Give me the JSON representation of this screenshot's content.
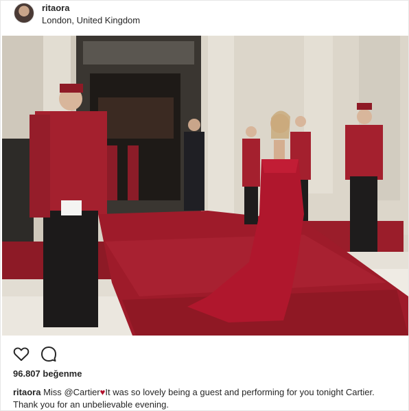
{
  "header": {
    "username": "ritaora",
    "location": "London, United Kingdom"
  },
  "photo": {
    "alt": ""
  },
  "actions": {
    "like_icon": "heart-outline-icon",
    "comment_icon": "speech-bubble-icon"
  },
  "likes": {
    "count": "96.807",
    "label": "beğenme"
  },
  "caption": {
    "username": "ritaora",
    "text_before_mention": "Miss",
    "mention": "@Cartier",
    "emoji": "♥",
    "text_after": "It was so lovely being a guest and performing for you tonight Cartier. Thank you for an unbelievable evening."
  },
  "colors": {
    "carpet": "#9e1b2a",
    "dress": "#b0172d",
    "uniform": "#a4202e",
    "stone": "#d8d2c6"
  }
}
